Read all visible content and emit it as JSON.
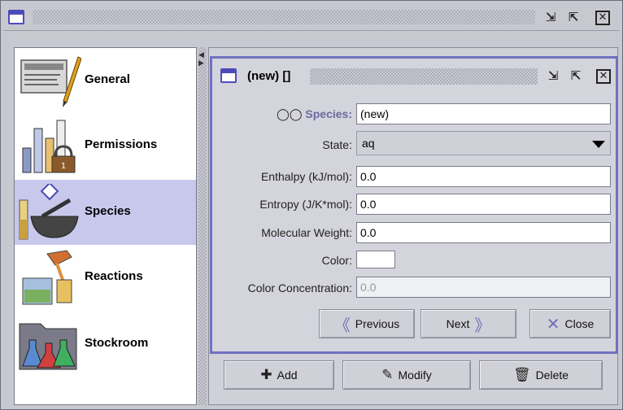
{
  "outer_window": {
    "icon": "window-icon",
    "controls": [
      "minimize-icon",
      "maximize-icon",
      "close-icon"
    ]
  },
  "sidebar": {
    "items": [
      {
        "label": "General",
        "icon": "general-icon"
      },
      {
        "label": "Permissions",
        "icon": "permissions-icon"
      },
      {
        "label": "Species",
        "icon": "species-icon",
        "selected": true
      },
      {
        "label": "Reactions",
        "icon": "reactions-icon"
      },
      {
        "label": "Stockroom",
        "icon": "stockroom-icon"
      }
    ]
  },
  "dialog": {
    "title": "(new) []",
    "fields": {
      "species_label": "Species:",
      "species_value": "(new)",
      "state_label": "State:",
      "state_value": "aq",
      "enthalpy_label": "Enthalpy (kJ/mol):",
      "enthalpy_value": "0.0",
      "entropy_label": "Entropy (J/K*mol):",
      "entropy_value": "0.0",
      "mw_label": "Molecular Weight:",
      "mw_value": "0.0",
      "color_label": "Color:",
      "color_value": "#ffffff",
      "color_conc_label": "Color Concentration:",
      "color_conc_value": "0.0"
    },
    "buttons": {
      "previous": "Previous",
      "next": "Next",
      "close": "Close"
    }
  },
  "panel_buttons": {
    "add": "Add",
    "modify": "Modify",
    "delete": "Delete"
  },
  "colors": {
    "selection": "#c8c8ec",
    "accent": "#7070c0"
  }
}
